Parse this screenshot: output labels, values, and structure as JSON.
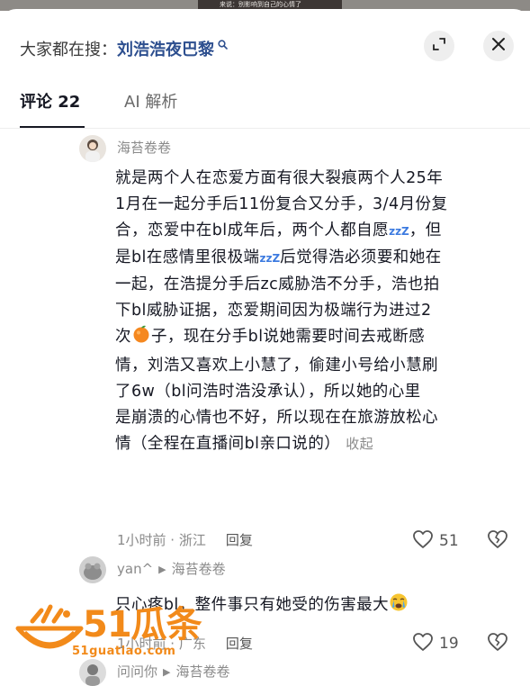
{
  "status_strip": {
    "caption": "来说：别影响到自己的心情了"
  },
  "header": {
    "search_prefix": "大家都在搜：",
    "search_term": "刘浩浩夜巴黎",
    "expand_icon": "expand-icon",
    "close_icon": "close-icon"
  },
  "tabs": [
    {
      "label": "评论 22",
      "active": true
    },
    {
      "label": "AI 解析",
      "active": false
    }
  ],
  "comments": [
    {
      "author": "海苔卷卷",
      "lines": [
        "就是两个人在恋爱方面有很大裂痕两个人25年",
        "1月在一起分手后11份复合又分手，3/4月份复",
        "合，恋爱中在bl成年后，两个人都自愿",
        "，但",
        "是bl在感情里很极端",
        "后觉得浩必须要和她在",
        "一起，在浩提分手后zc威胁浩不分手，浩也拍",
        "下bl威胁证据，恋爱期间因为极端行为进过2",
        "次",
        "子，现在分手bl说她需要时间去戒断感",
        "情，刘浩又喜欢上小慧了，偷建小号给小慧刷",
        "了6w（bl问浩时浩没承认），所以她的心里",
        "是崩溃的心情也不好，所以现在在旅游放松心",
        "情（全程在直播间bl亲口说的）"
      ],
      "zzz": "zzZ",
      "collapse_label": "收起",
      "time_location": "1小时前 · 浙江",
      "reply_label": "回复",
      "likes": "51"
    },
    {
      "author": "yan^",
      "reply_to": "海苔卷卷",
      "text": "只心疼bl，整件事只有她受的伤害最大",
      "time_location": "1小时前 · 广东",
      "reply_label": "回复",
      "likes": "19"
    },
    {
      "author": "问问你",
      "reply_to": "海苔卷卷"
    }
  ],
  "watermark": {
    "number": "51瓜条",
    "url": "51guatiao.com"
  },
  "colors": {
    "link": "#2d4f8f",
    "accent_zzz": "#3d7be0",
    "watermark": "#f28a1a",
    "meta": "#8a8a8a"
  }
}
